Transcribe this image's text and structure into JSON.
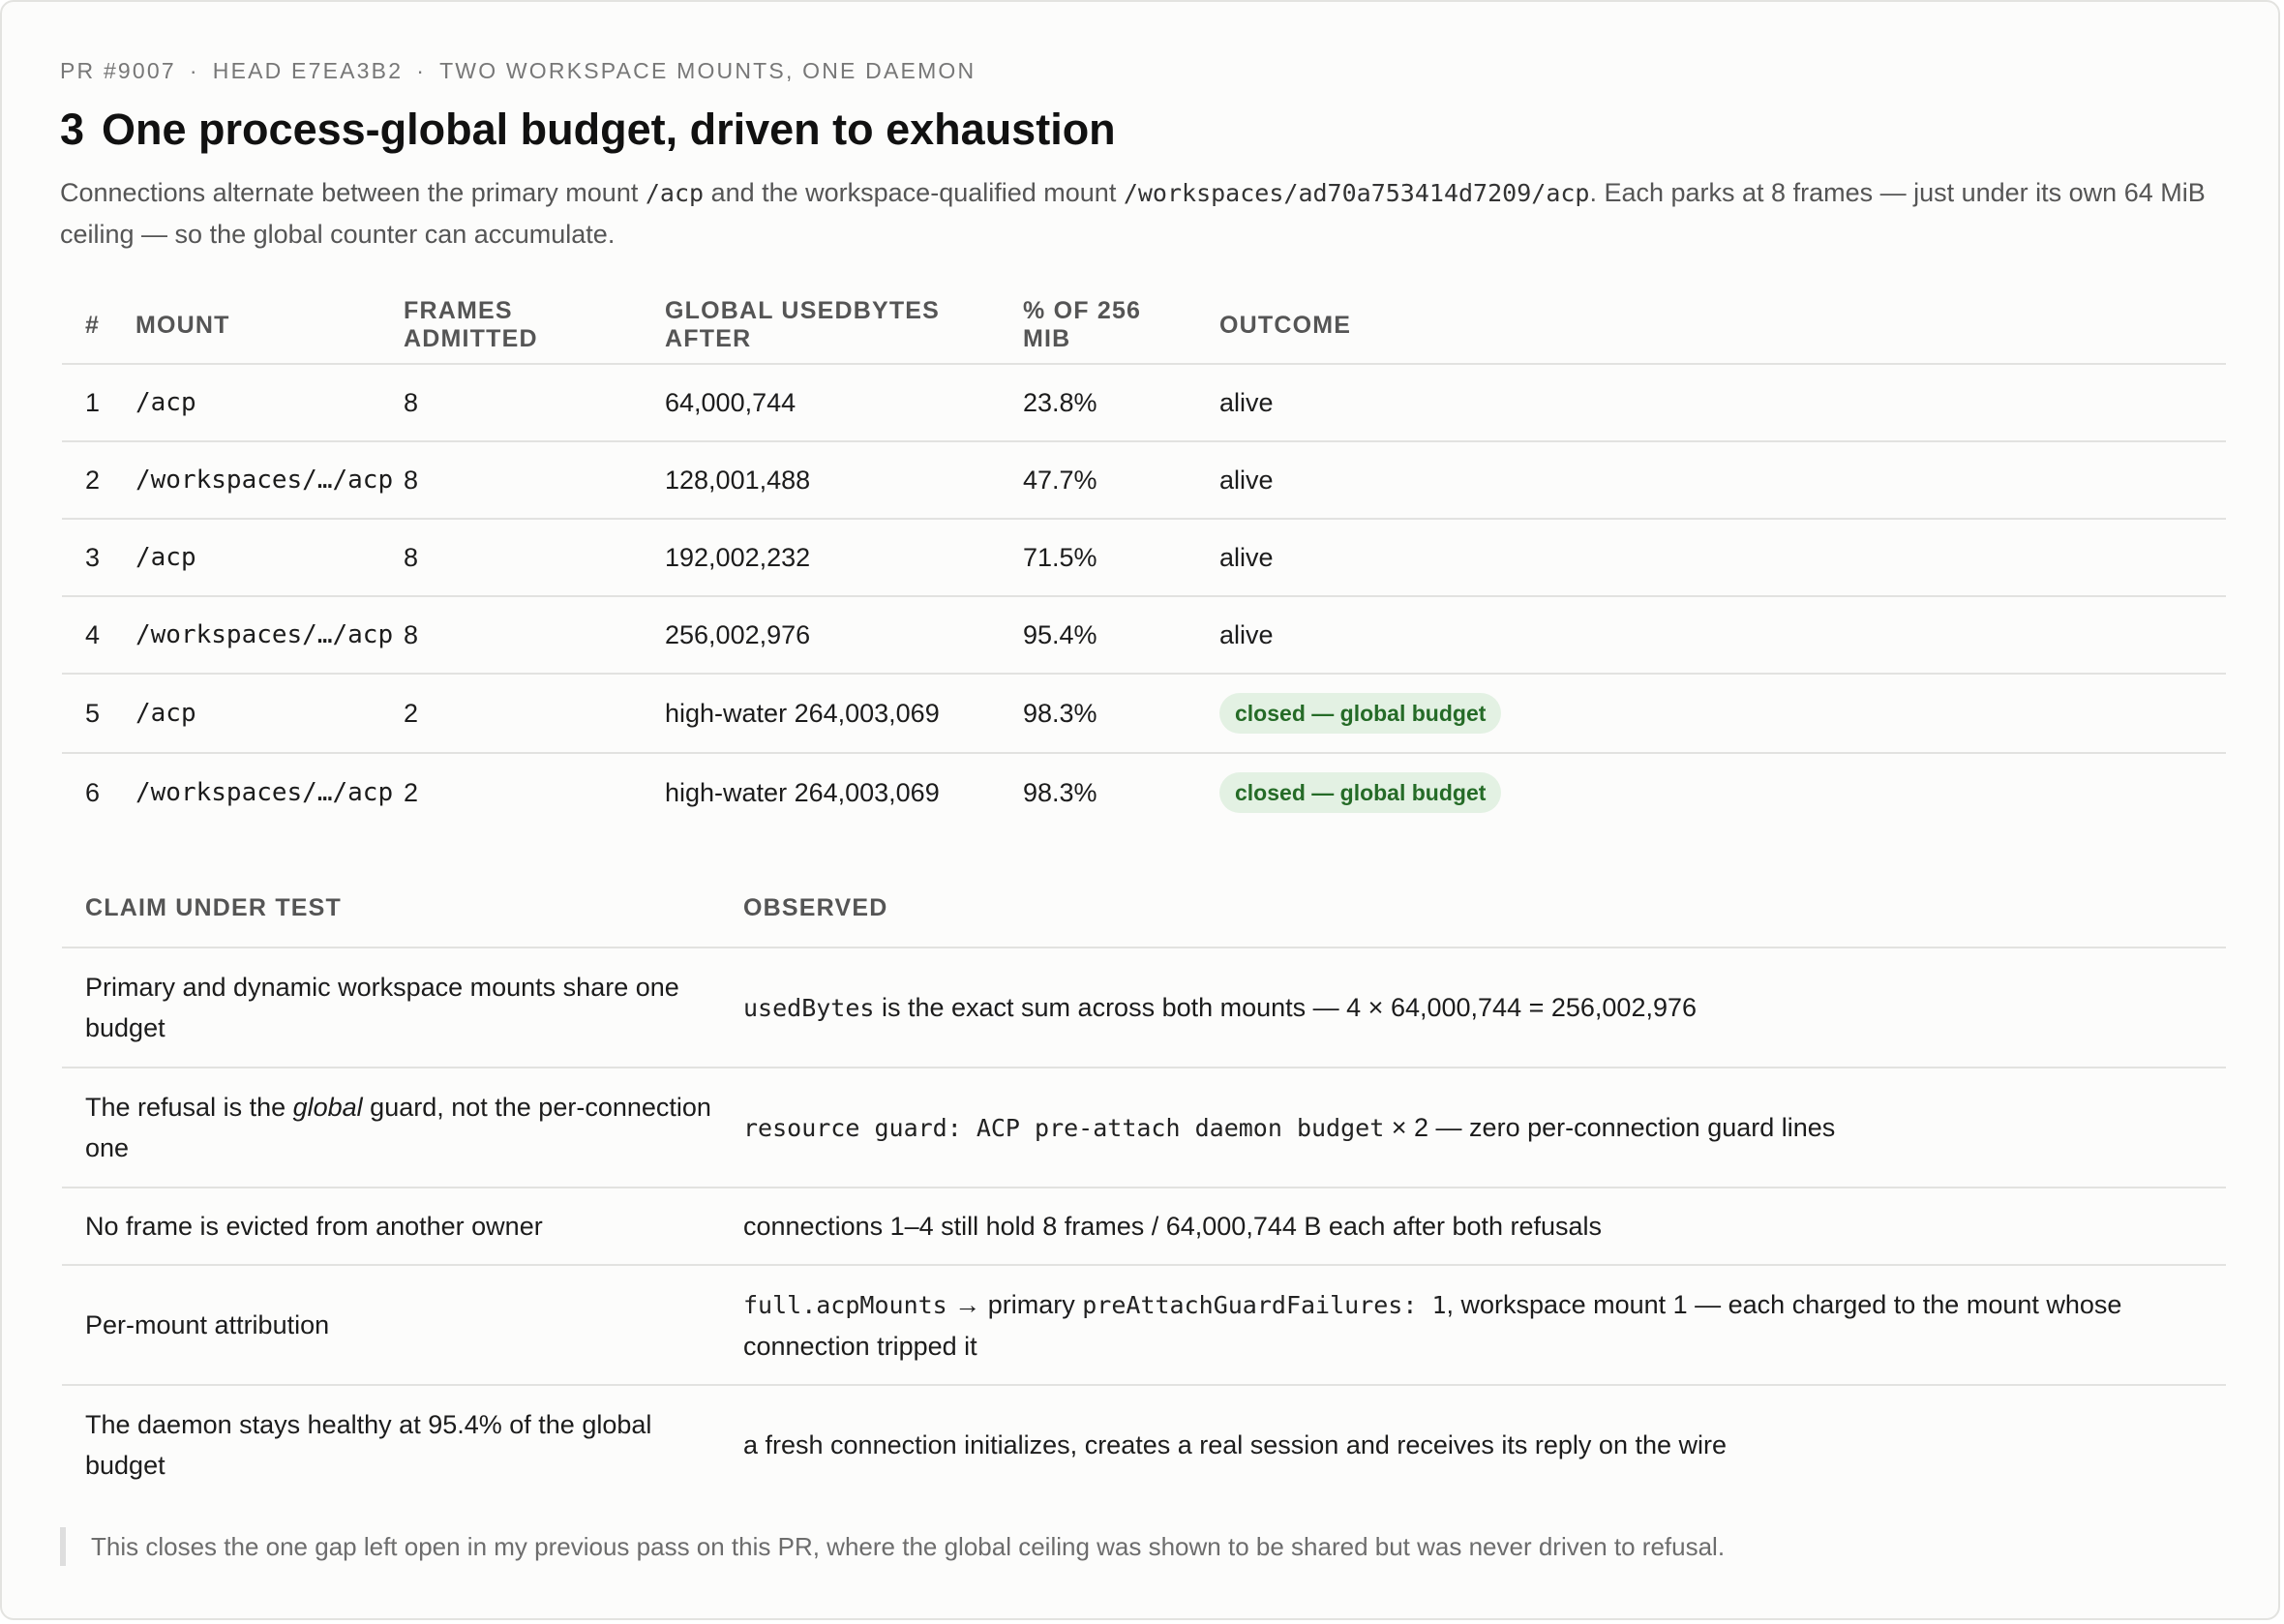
{
  "header": {
    "pr": "PR #9007",
    "head": "HEAD E7EA3B2",
    "context": "TWO WORKSPACE MOUNTS, ONE DAEMON",
    "separator": "·"
  },
  "title": {
    "number": "3",
    "text": "One process-global budget, driven to exhaustion"
  },
  "intro": {
    "part1": "Connections alternate between the primary mount ",
    "code1": "/acp",
    "part2": " and the workspace-qualified mount ",
    "code2": "/workspaces/ad70a753414d7209/acp",
    "part3": ". Each parks at 8 frames — just under its own 64 MiB ceiling — so the global counter can accumulate."
  },
  "connections_table": {
    "headers": [
      "#",
      "MOUNT",
      "FRAMES ADMITTED",
      "GLOBAL USEDBYTES AFTER",
      "% OF 256 MIB",
      "OUTCOME"
    ],
    "rows": [
      {
        "n": "1",
        "mount": "/acp",
        "frames": "8",
        "used": "64,000,744",
        "pct": "23.8%",
        "outcome": "alive"
      },
      {
        "n": "2",
        "mount": "/workspaces/…/acp",
        "frames": "8",
        "used": "128,001,488",
        "pct": "47.7%",
        "outcome": "alive"
      },
      {
        "n": "3",
        "mount": "/acp",
        "frames": "8",
        "used": "192,002,232",
        "pct": "71.5%",
        "outcome": "alive"
      },
      {
        "n": "4",
        "mount": "/workspaces/…/acp",
        "frames": "8",
        "used": "256,002,976",
        "pct": "95.4%",
        "outcome": "alive"
      },
      {
        "n": "5",
        "mount": "/acp",
        "frames": "2",
        "used": "high-water 264,003,069",
        "pct": "98.3%",
        "outcome": "closed — global budget"
      },
      {
        "n": "6",
        "mount": "/workspaces/…/acp",
        "frames": "2",
        "used": "high-water 264,003,069",
        "pct": "98.3%",
        "outcome": "closed — global budget"
      }
    ]
  },
  "claims_table": {
    "headers": [
      "CLAIM UNDER TEST",
      "OBSERVED"
    ],
    "rows": [
      {
        "claim": "Primary and dynamic workspace mounts share one budget",
        "obs_code1": "usedBytes",
        "obs_text1": " is the exact sum across both mounts — 4 × 64,000,744 = 256,002,976"
      },
      {
        "claim_pre": "The refusal is the ",
        "claim_em": "global",
        "claim_post": " guard, not the per-connection one",
        "obs_code1": "resource guard: ACP pre-attach daemon budget",
        "obs_text1": " × 2 — zero per-connection guard lines"
      },
      {
        "claim": "No frame is evicted from another owner",
        "obs_text1": "connections 1–4 still hold 8 frames / 64,000,744 B each after both refusals"
      },
      {
        "claim": "Per-mount attribution",
        "obs_code1": "full.acpMounts",
        "obs_text1": " → primary ",
        "obs_code2": "preAttachGuardFailures: 1",
        "obs_text2": ", workspace mount 1 — each charged to the mount whose connection tripped it"
      },
      {
        "claim": "The daemon stays healthy at 95.4% of the global budget",
        "obs_text1": "a fresh connection initializes, creates a real session and receives its reply on the wire"
      }
    ]
  },
  "footnote": "This closes the one gap left open in my previous pass on this PR, where the global ceiling was shown to be shared but was never driven to refusal.",
  "colors": {
    "pill_bg": "#e3f1e3",
    "pill_text": "#256b27",
    "card_border": "#e3e3e0"
  }
}
